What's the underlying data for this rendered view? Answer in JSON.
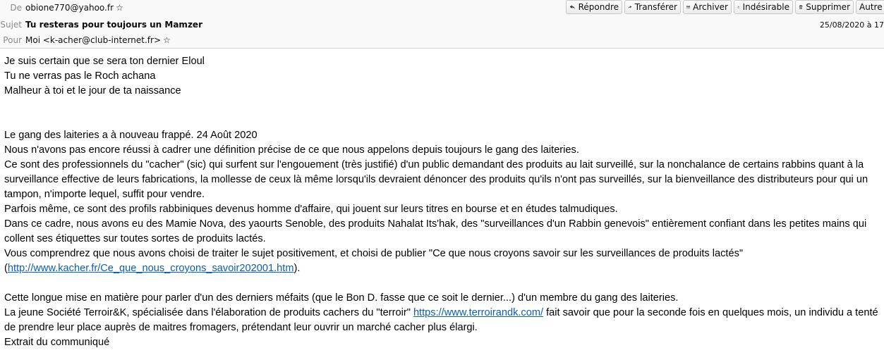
{
  "header": {
    "from_label": "De",
    "from_value": "obione770@yahoo.fr",
    "subject_label": "Sujet",
    "subject_value": "Tu resteras pour toujours un Mamzer",
    "to_label": "Pour",
    "to_value": "Moi <k-acher@club-internet.fr>",
    "date": "25/08/2020 à 17"
  },
  "toolbar": {
    "reply": "Répondre",
    "forward": "Transférer",
    "archive": "Archiver",
    "junk": "Indésirable",
    "delete": "Supprimer",
    "other": "Autre"
  },
  "body": {
    "l1": "Je suis certain que se sera ton dernier Eloul",
    "l2": "Tu ne verras pas le Roch achana",
    "l3": "Malheur à toi et le jour de ta naissance",
    "l4": "Le gang des laiteries a à nouveau frappé. 24 Août 2020",
    "l5": "Nous n'avons pas encore réussi à cadrer une définition précise de ce que nous appelons depuis toujours le gang des laiteries.",
    "l6": "Ce sont des professionnels du \"cacher\" (sic) qui surfent sur l'engouement (très justifié) d'un public demandant des produits au lait surveillé, sur la nonchalance de certains rabbins quant à la surveillance effective de leurs fabrications, la mollesse de ceux là même lorsqu'ils devraient dénoncer des produits qu'ils n'ont pas surveillés, sur la bienveillance des distributeurs pour qui un tampon, n'importe lequel, suffit pour vendre.",
    "l7": "Parfois même, ce sont des profils rabbiniques devenus homme d'affaire, qui jouent sur leurs titres en bourse et en études talmudiques.",
    "l8": "Dans ce cadre, nous avons eu des Mamie Nova, des yaourts Senoble, des produits Nahalat Its'hak, des \"surveillances d'un Rabbin genevois\" entièrement confiant dans les petites mains qui collent ses étiquettes sur toutes sortes de produits lactés.",
    "l9_pre": "Vous comprendrez que nous avons choisi de traiter le sujet positivement, et choisi de publier \"Ce que nous croyons savoir sur les surveillances de produits lactés\" (",
    "l9_link": "http://www.kacher.fr/Ce_que_nous_croyons_savoir202001.htm",
    "l9_post": ").",
    "l10": "Cette longue mise en matière pour parler d'un des derniers méfaits (que le Bon D. fasse que ce soit le dernier...) d'un membre du gang des laiteries.",
    "l11_pre": "La jeune Société Terroir&K, spécialisée dans l'élaboration de produits cachers du \"terroir\" ",
    "l11_link": "https://www.terroirandk.com/",
    "l11_post": " fait savoir que pour la seconde fois en quelques mois, un individu a tenté de prendre leur place auprès de maitres fromagers, prétendant leur ouvrir un marché cacher plus élargi.",
    "l12": "Extrait du communiqué"
  }
}
